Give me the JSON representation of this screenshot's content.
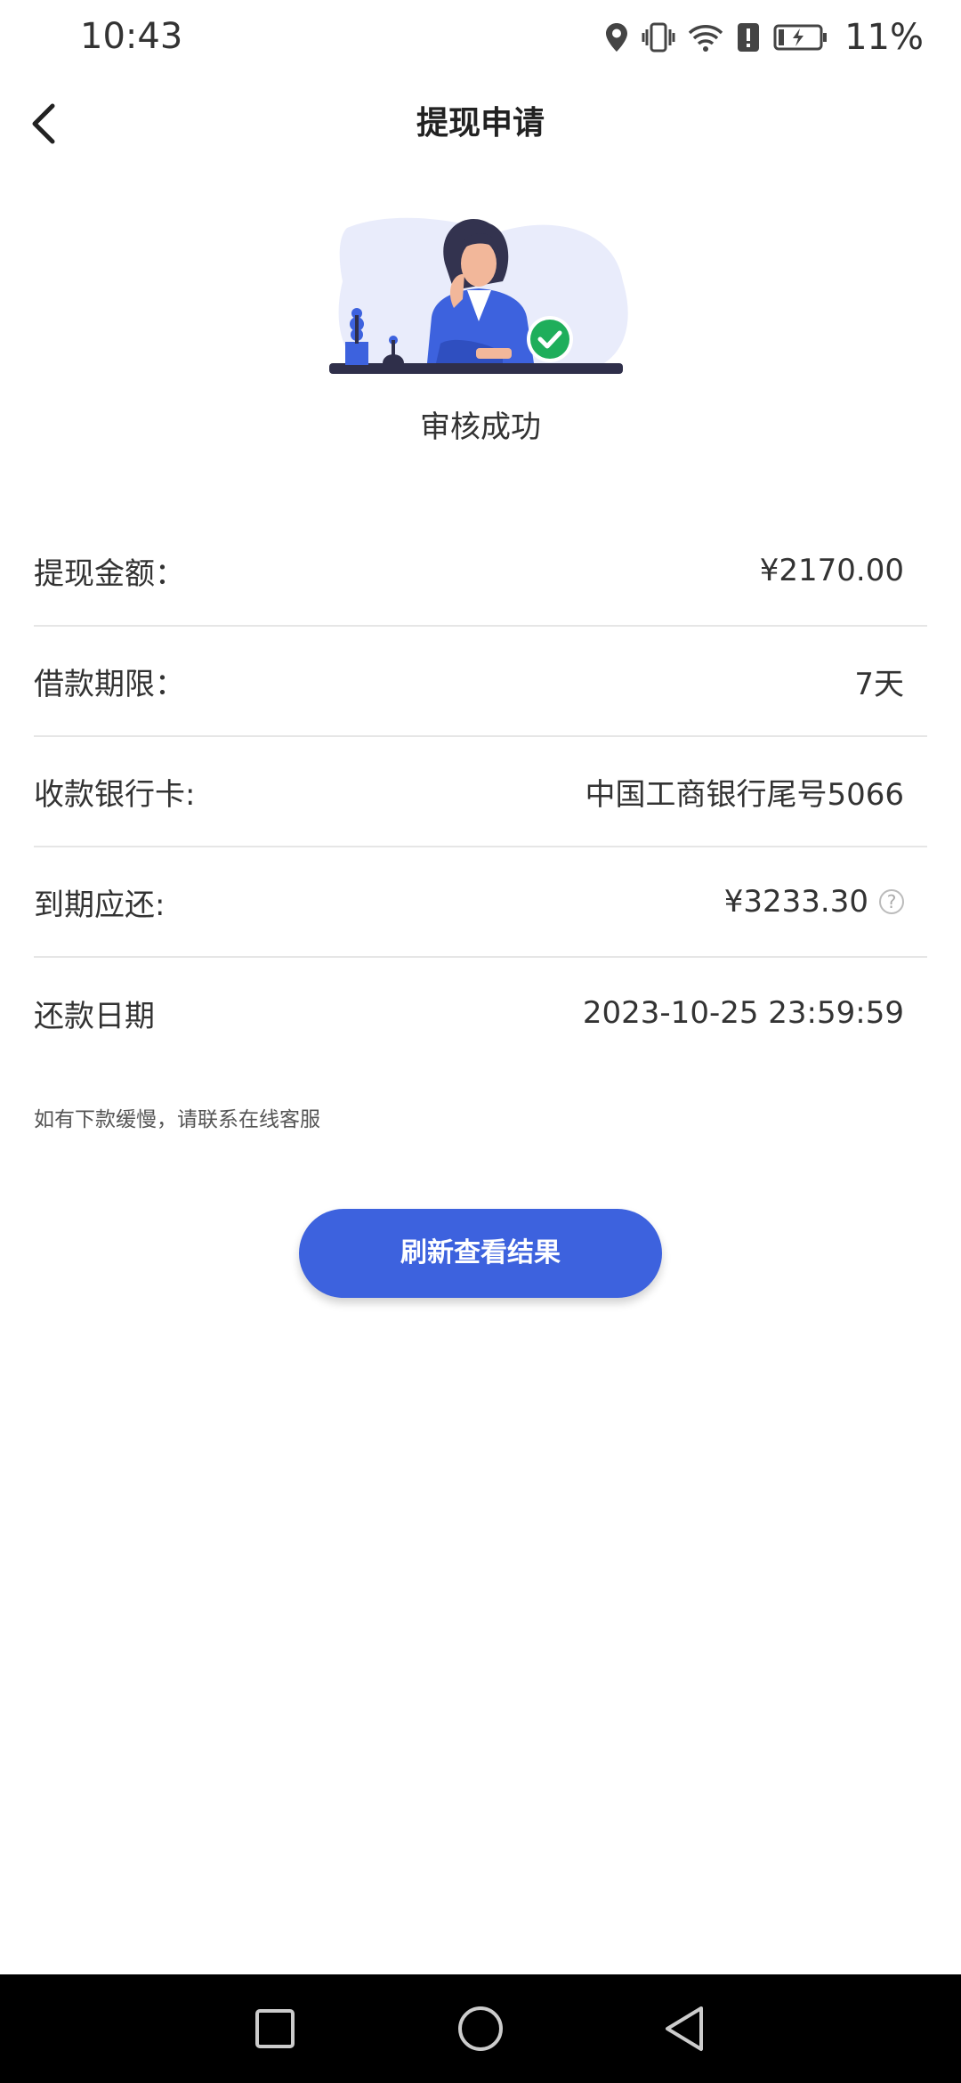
{
  "status_bar": {
    "time": "10:43",
    "battery": "11%",
    "icons": [
      "location-icon",
      "vibrate-icon",
      "wifi-icon",
      "alert-icon",
      "battery-charging-icon"
    ]
  },
  "header": {
    "title": "提现申请",
    "back_icon": "chevron-left-icon"
  },
  "status": {
    "text": "审核成功",
    "accent_color": "#3d62de",
    "success_color": "#1fae5b"
  },
  "details": [
    {
      "label": "提现金额：",
      "value": "¥2170.00"
    },
    {
      "label": "借款期限：",
      "value": "7天"
    },
    {
      "label": "收款银行卡:",
      "value": "中国工商银行尾号5066"
    },
    {
      "label": "到期应还:",
      "value": "¥3233.30",
      "help_icon": "?"
    },
    {
      "label": "还款日期",
      "value": "2023-10-25 23:59:59"
    }
  ],
  "notice": "如有下款缓慢，请联系在线客服",
  "button": {
    "label": "刷新查看结果",
    "color": "#3d62de"
  },
  "system_nav": {
    "icons": [
      "square-recents-icon",
      "circle-home-icon",
      "triangle-back-icon"
    ]
  }
}
